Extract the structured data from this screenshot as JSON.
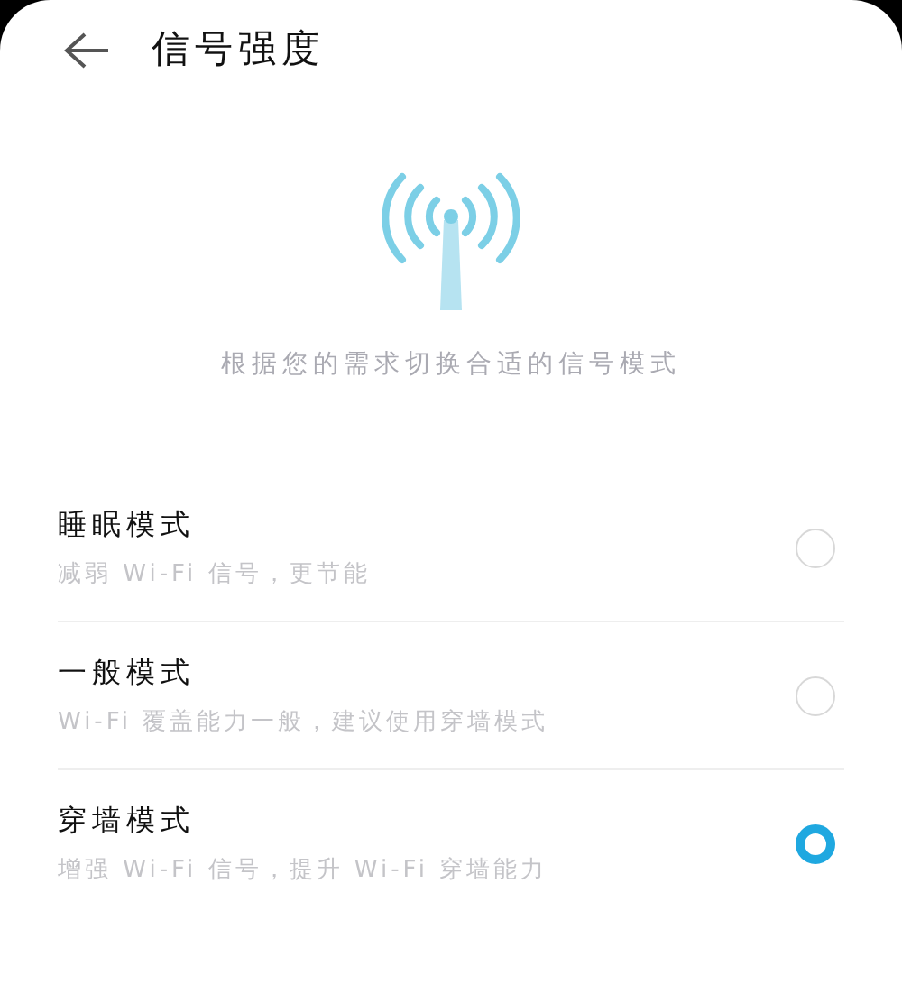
{
  "header": {
    "title": "信号强度"
  },
  "description": "根据您的需求切换合适的信号模式",
  "modes": [
    {
      "title": "睡眠模式",
      "subtitle": "减弱 Wi-Fi 信号，更节能",
      "selected": false
    },
    {
      "title": "一般模式",
      "subtitle": "Wi-Fi 覆盖能力一般，建议使用穿墙模式",
      "selected": false
    },
    {
      "title": "穿墙模式",
      "subtitle": "增强 Wi-Fi 信号，提升 Wi-Fi 穿墙能力",
      "selected": true
    }
  ]
}
